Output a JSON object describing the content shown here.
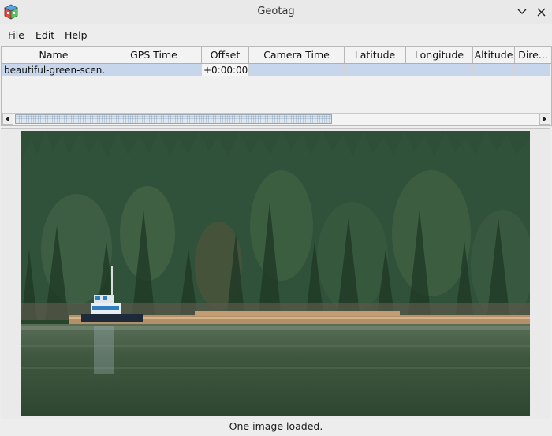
{
  "window": {
    "title": "Geotag"
  },
  "menu": {
    "items": [
      "File",
      "Edit",
      "Help"
    ]
  },
  "table": {
    "columns": [
      "Name",
      "GPS Time",
      "Offset",
      "Camera Time",
      "Latitude",
      "Longitude",
      "Altitude",
      "Dire..."
    ],
    "rows": [
      {
        "name": "beautiful-green-scen...",
        "gps_time": "",
        "offset": "+0:00:00",
        "camera_time": "",
        "latitude": "",
        "longitude": "",
        "altitude": "",
        "direction": ""
      }
    ]
  },
  "scrollbar": {
    "position_fraction": 0.0
  },
  "image": {
    "icon": "landscape-photo"
  },
  "status": {
    "text": "One image loaded."
  },
  "colors": {
    "selection": "#c7d6ea",
    "water": "#3e5740",
    "forest": "#23432b"
  }
}
